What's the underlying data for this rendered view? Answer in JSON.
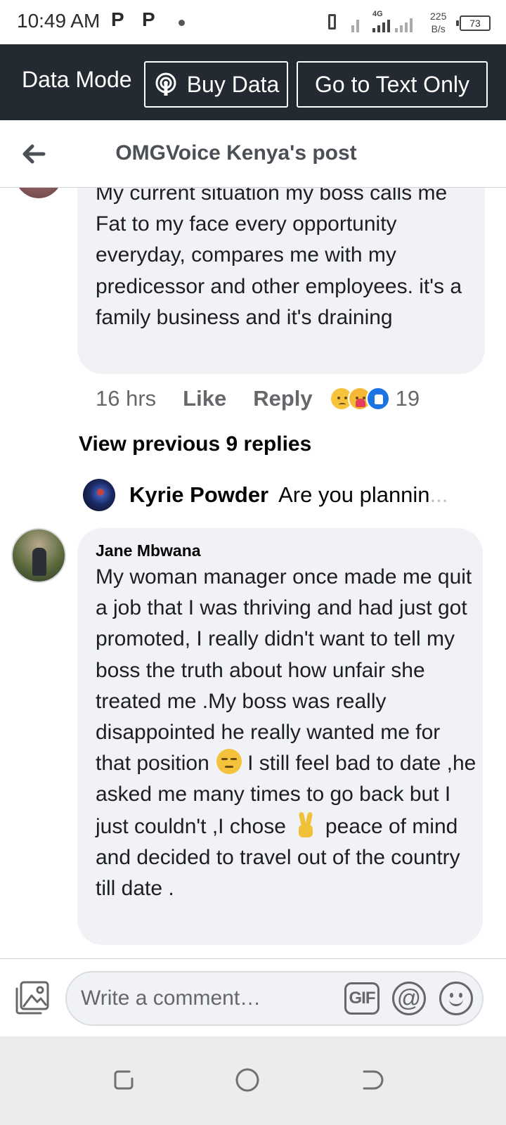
{
  "status_bar": {
    "time": "10:49 AM",
    "notif_1": "P",
    "notif_2": "P",
    "network_label": "4G",
    "speed_value": "225",
    "speed_unit": "B/s",
    "battery": "73"
  },
  "data_bar": {
    "label": "Data Mode",
    "buy_data": "Buy Data",
    "text_only": "Go to Text Only"
  },
  "header": {
    "title": "OMGVoice Kenya's post"
  },
  "comment_1": {
    "text": "My current situation my boss calls me Fat to my face every opportunity everyday, compares me with my predicessor and other employees. it's a family business and it's draining",
    "time": "16 hrs",
    "like": "Like",
    "reply": "Reply",
    "reaction_count": "19",
    "reactions": [
      "sad-icon",
      "care-icon",
      "like-icon"
    ]
  },
  "view_previous": "View previous 9 replies",
  "reply_preview": {
    "name": "Kyrie Powder",
    "snippet": "Are you plannin",
    "ellipsis": "..."
  },
  "comment_2": {
    "name": "Jane Mbwana",
    "part_1": "My woman manager once made me quit a job that I was thriving and had just got promoted, I really didn't want to tell my boss the truth about how unfair she treated me .My boss was really disappointed he really wanted me for that position",
    "part_2": "I still feel bad to date ,he asked me many times to go back but I just couldn't ,I chose",
    "part_3": "peace of mind and decided to travel out of the country till date ."
  },
  "composer": {
    "placeholder": "Write a comment…",
    "gif": "GIF",
    "at": "@"
  },
  "colors": {
    "data_bar_bg": "#242a31",
    "bubble_bg": "#f0f2f5",
    "like_blue": "#1b74e4"
  }
}
